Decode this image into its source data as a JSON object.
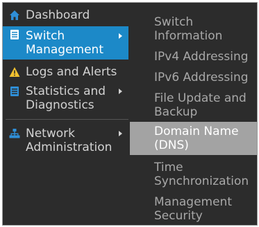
{
  "main_menu": {
    "items": [
      {
        "label": "Dashboard",
        "icon": "home-icon"
      },
      {
        "line1": "Switch",
        "line2": "Management",
        "icon": "list-icon",
        "active": true
      },
      {
        "label": "Logs and Alerts",
        "icon": "warning-icon"
      },
      {
        "line1": "Statistics and",
        "line2": "Diagnostics",
        "icon": "list-icon"
      },
      {
        "line1": "Network",
        "line2": "Administration",
        "icon": "network-icon"
      }
    ]
  },
  "sub_menu": {
    "items": [
      {
        "line1": "Switch",
        "line2": "Information"
      },
      {
        "label": "IPv4 Addressing"
      },
      {
        "label": "IPv6 Addressing"
      },
      {
        "line1": "File Update and",
        "line2": "Backup"
      },
      {
        "line1": "Domain Name",
        "line2": "(DNS)",
        "highlighted": true
      },
      {
        "line1": "Time",
        "line2": "Synchronization"
      },
      {
        "line1": "Management",
        "line2": "Security"
      }
    ]
  },
  "colors": {
    "background": "#2c2c2c",
    "active": "#1c89c8",
    "highlight": "#a3a3a3",
    "text": "#d2d2d2",
    "subtext": "#a8a8a8",
    "warning": "#f2c230"
  }
}
